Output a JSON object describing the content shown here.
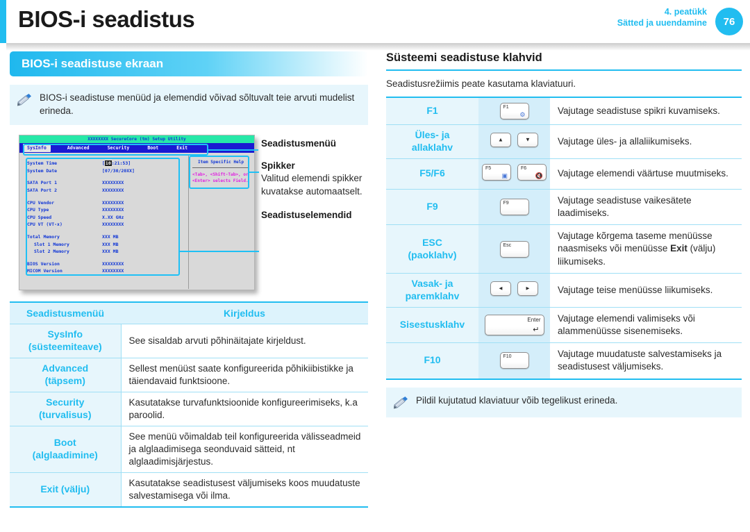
{
  "header": {
    "title": "BIOS-i seadistus",
    "chapter_number": "4. peatükk",
    "chapter_name": "Sätted ja uuendamine",
    "page_number": "76",
    "accent_color": "#21bdf0"
  },
  "left": {
    "section_title": "BIOS-i seadistuse ekraan",
    "note": "BIOS-i seadistuse menüüd ja elemendid võivad sõltuvalt teie arvuti mudelist erineda.",
    "bios_screen": {
      "window_title": "XXXXXXXX SecureCore (tm) Setup Utility",
      "tabs": [
        "SysInfo",
        "Advanced",
        "Security",
        "Boot",
        "Exit"
      ],
      "active_tab": "SysInfo",
      "items": [
        {
          "label": "System Time",
          "value": "[10:21:53]",
          "highlight": "10"
        },
        {
          "label": "System Date",
          "value": "[07/30/20XX]"
        },
        {
          "label": "SATA Port 1",
          "value": "XXXXXXXX"
        },
        {
          "label": "SATA Port 2",
          "value": "XXXXXXXX"
        },
        {
          "label": "CPU Vendor",
          "value": "XXXXXXXX"
        },
        {
          "label": "CPU Type",
          "value": "XXXXXXXX"
        },
        {
          "label": "CPU Speed",
          "value": "X.XX GHz"
        },
        {
          "label": "CPU VT (VT-x)",
          "value": "XXXXXXXX"
        },
        {
          "label": "Total Memory",
          "value": "XXX MB"
        },
        {
          "label": "Slot 1 Memory",
          "value": "XXX MB"
        },
        {
          "label": "Slot 2 Memory",
          "value": "XXX MB"
        },
        {
          "label": "BIOS Version",
          "value": "XXXXXXXX"
        },
        {
          "label": "MICOM Version",
          "value": "XXXXXXXX"
        }
      ],
      "help_title": "Item Specific Help",
      "help_text": "<Tab>, <Shift-Tab>, or <Enter> selects Field."
    },
    "callouts": {
      "setup_menu": "Seadistusmenüü",
      "helper": "Spikker",
      "helper_body": "Valitud elemendi spikker kuvatakse automaatselt.",
      "setup_items": "Seadistuselemendid"
    },
    "table": {
      "headers": [
        "Seadistusmenüü",
        "Kirjeldus"
      ],
      "rows": [
        {
          "name": "SysInfo\n(süsteemiteave)",
          "desc": "See sisaldab arvuti põhinäitajate kirjeldust."
        },
        {
          "name": "Advanced\n(täpsem)",
          "desc": "Sellest menüüst saate konfigureerida põhikiibistikke ja täiendavaid funktsioone."
        },
        {
          "name": "Security\n(turvalisus)",
          "desc": "Kasutatakse turvafunktsioonide konfigureerimiseks, k.a paroolid."
        },
        {
          "name": "Boot\n(alglaadimine)",
          "desc": "See menüü võimaldab teil konfigureerida välisseadmeid ja alglaadimisega seonduvaid sätteid, nt alglaadimisjärjestus."
        },
        {
          "name": "Exit (välju)",
          "desc": "Kasutatakse seadistusest väljumiseks koos muudatuste salvestamisega või ilma."
        }
      ]
    }
  },
  "right": {
    "section_title": "Süsteemi seadistuse klahvid",
    "intro": "Seadistusrežiimis peate kasutama klaviatuuri.",
    "rows": [
      {
        "key": "F1",
        "caps": [
          "F1"
        ],
        "desc": "Vajutage seadistuse spikri kuvamiseks."
      },
      {
        "key": "Üles- ja\nallaklahv",
        "caps": [
          "▲",
          "▼"
        ],
        "desc": "Vajutage üles- ja allaliikumiseks."
      },
      {
        "key": "F5/F6",
        "caps": [
          "F5",
          "F6"
        ],
        "desc": "Vajutage elemendi väärtuse muutmiseks."
      },
      {
        "key": "F9",
        "caps": [
          "F9"
        ],
        "desc": "Vajutage seadistuse vaikesätete laadimiseks."
      },
      {
        "key": "ESC\n(paoklahv)",
        "caps": [
          "Esc"
        ],
        "desc_pre": "Vajutage kõrgema taseme menüüsse naasmiseks või menüüsse ",
        "desc_bold": "Exit",
        "desc_post": " (välju) liikumiseks."
      },
      {
        "key": "Vasak- ja\nparemklahv",
        "caps": [
          "◄",
          "►"
        ],
        "desc": "Vajutage teise menüüsse liikumiseks."
      },
      {
        "key": "Sisestusklahv",
        "caps": [
          "Enter"
        ],
        "desc": "Vajutage elemendi valimiseks või alammenüüsse sisenemiseks."
      },
      {
        "key": "F10",
        "caps": [
          "F10"
        ],
        "desc": "Vajutage muudatuste salvestamiseks ja seadistusest väljumiseks."
      }
    ],
    "note": "Pildil kujutatud klaviatuur võib tegelikust erineda."
  }
}
